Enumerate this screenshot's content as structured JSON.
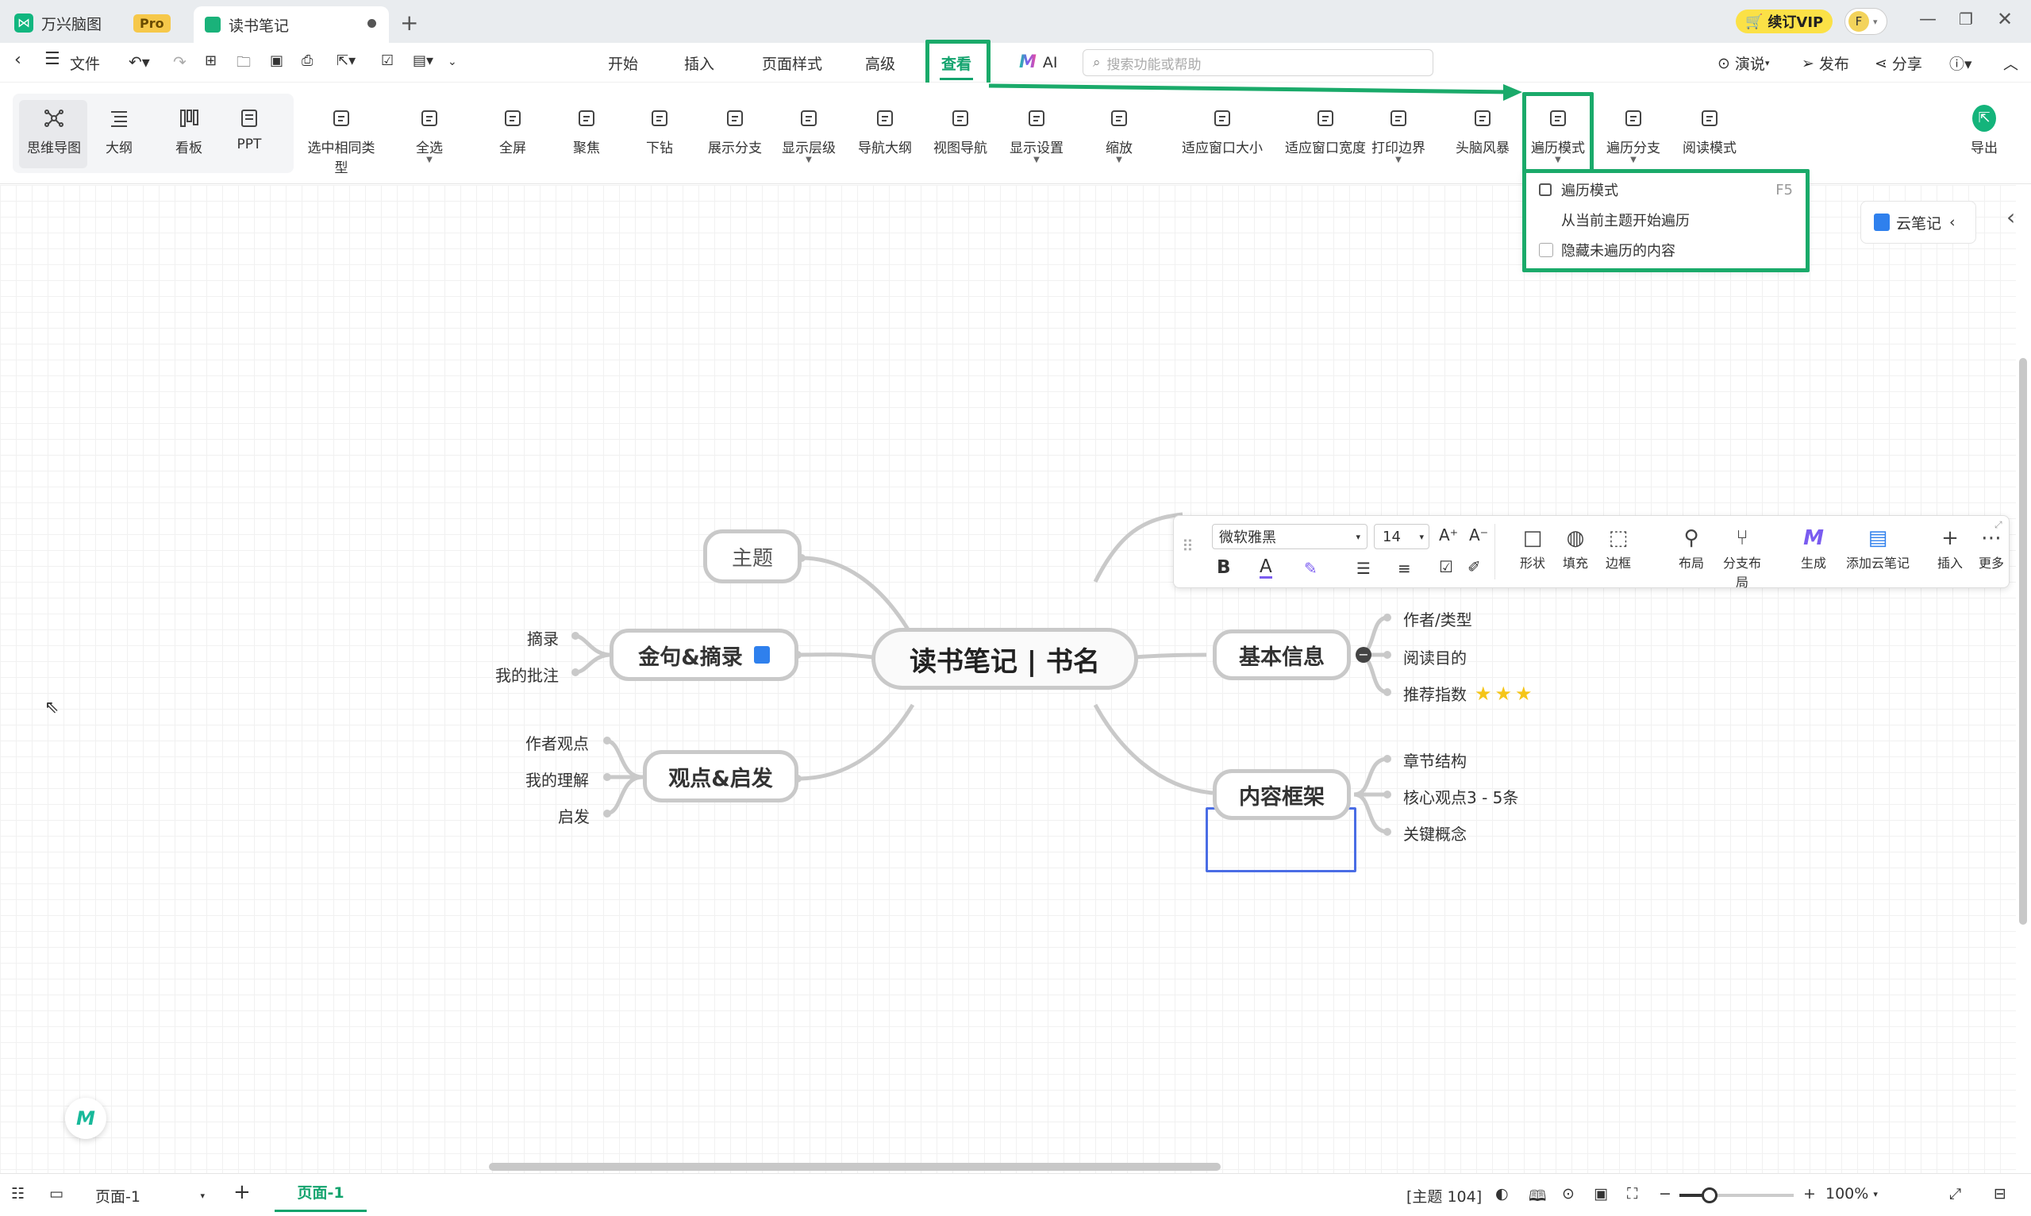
{
  "window": {
    "app_name": "万兴脑图",
    "pro_badge": "Pro",
    "doc_tab": "读书笔记",
    "vip_button": "续订VIP",
    "avatar_letter": "F"
  },
  "menubar": {
    "file": "文件",
    "tabs": [
      "开始",
      "插入",
      "页面样式",
      "高级",
      "查看",
      "AI"
    ],
    "active_tab": "查看",
    "search_placeholder": "搜索功能或帮助",
    "present": "演说",
    "publish": "发布",
    "share": "分享"
  },
  "ribbon": {
    "view_modes": [
      {
        "label": "思维导图",
        "icon": "mindmap-icon"
      },
      {
        "label": "大纲",
        "icon": "outline-icon"
      },
      {
        "label": "看板",
        "icon": "kanban-icon"
      },
      {
        "label": "PPT",
        "icon": "ppt-icon"
      }
    ],
    "tools": [
      {
        "label": "选中相同类型",
        "icon": "select-same-icon"
      },
      {
        "label": "全选",
        "icon": "select-all-icon"
      },
      {
        "label": "全屏",
        "icon": "fullscreen-icon"
      },
      {
        "label": "聚焦",
        "icon": "focus-icon"
      },
      {
        "label": "下钻",
        "icon": "drill-down-icon"
      },
      {
        "label": "展示分支",
        "icon": "show-branch-icon"
      },
      {
        "label": "显示层级",
        "icon": "show-level-icon"
      },
      {
        "label": "导航大纲",
        "icon": "nav-outline-icon"
      },
      {
        "label": "视图导航",
        "icon": "view-nav-icon"
      },
      {
        "label": "显示设置",
        "icon": "display-settings-icon"
      },
      {
        "label": "缩放",
        "icon": "zoom-icon"
      },
      {
        "label": "适应窗口大小",
        "icon": "fit-window-icon"
      },
      {
        "label": "适应窗口宽度",
        "icon": "fit-width-icon"
      },
      {
        "label": "打印边界",
        "icon": "print-border-icon"
      },
      {
        "label": "头脑风暴",
        "icon": "brainstorm-icon"
      },
      {
        "label": "遍历模式",
        "icon": "traverse-mode-icon"
      },
      {
        "label": "遍历分支",
        "icon": "traverse-branch-icon"
      },
      {
        "label": "阅读模式",
        "icon": "reading-mode-icon"
      }
    ],
    "export": "导出"
  },
  "dropdown": {
    "items": [
      {
        "label": "遍历模式",
        "shortcut": "F5"
      },
      {
        "label": "从当前主题开始遍历",
        "shortcut": ""
      },
      {
        "label": "隐藏未遍历的内容",
        "shortcut": ""
      }
    ]
  },
  "cloud_note": "云笔记",
  "mindmap": {
    "central": "读书笔记 | 书名",
    "topic": "主题",
    "branches": {
      "quotes": "金句&摘录",
      "views": "观点&启发",
      "basic": "基本信息",
      "framework": "内容框架"
    },
    "leaves": {
      "quotes": [
        "摘录",
        "我的批注"
      ],
      "views": [
        "作者观点",
        "我的理解",
        "启发"
      ],
      "basic": [
        "作者/类型",
        "阅读目的",
        "推荐指数"
      ],
      "framework": [
        "章节结构",
        "核心观点3 - 5条",
        "关键概念"
      ]
    },
    "rating_stars": 3
  },
  "float_toolbar": {
    "font": "微软雅黑",
    "size": "14",
    "bold": "B",
    "color_a": "A",
    "buttons": [
      "形状",
      "填充",
      "边框",
      "布局",
      "分支布局",
      "生成",
      "添加云笔记",
      "插入",
      "更多"
    ]
  },
  "status": {
    "page_select": "页面-1",
    "page_tab": "页面-1",
    "topic_count": "[主题 104]",
    "zoom": "100%"
  },
  "colors": {
    "highlight": "#1aaa6a",
    "accent_green": "#12b07a",
    "selected_border": "#4a6de5",
    "node_border": "#c9c9c9"
  }
}
